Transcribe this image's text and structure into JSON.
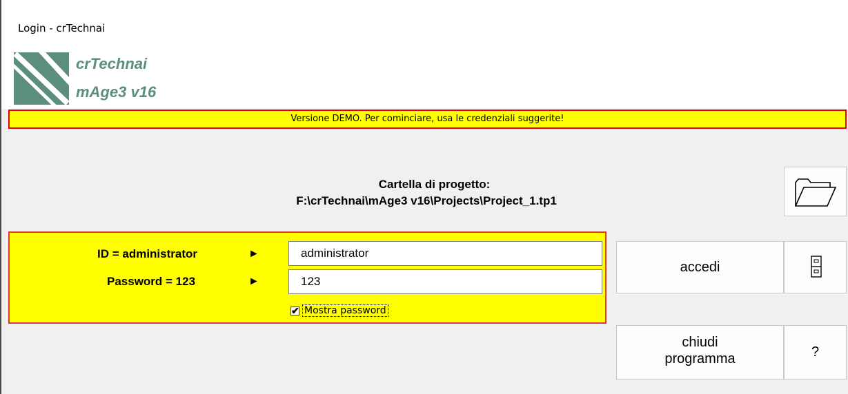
{
  "window": {
    "title": "Login - crTechnai"
  },
  "header": {
    "app_name_line1": "crTechnai",
    "app_name_line2": "mAge3 v16",
    "logo_icon": "crtechnai-logo-icon"
  },
  "banner": {
    "text": "Versione DEMO. Per cominciare, usa le credenziali suggerite!",
    "bg_color": "#ffff00",
    "border_color": "#e00000"
  },
  "project": {
    "label": "Cartella di progetto:",
    "path": "F:\\crTechnai\\mAge3 v16\\Projects\\Project_1.tp1",
    "browse_icon": "folder-open-icon"
  },
  "login": {
    "id_hint": "ID = administrator",
    "password_hint": "Password = 123",
    "arrow_glyph": "►",
    "id_value": "administrator",
    "password_value": "123",
    "show_password_label": "Mostra password",
    "show_password_checked": true,
    "panel_bg": "#ffff00"
  },
  "buttons": {
    "accedi": "accedi",
    "chiudi_line1": "chiudi",
    "chiudi_line2": "programma",
    "help": "?",
    "side_icon": "file-cabinet-icon"
  },
  "colors": {
    "brand": "#5b8e7d"
  }
}
